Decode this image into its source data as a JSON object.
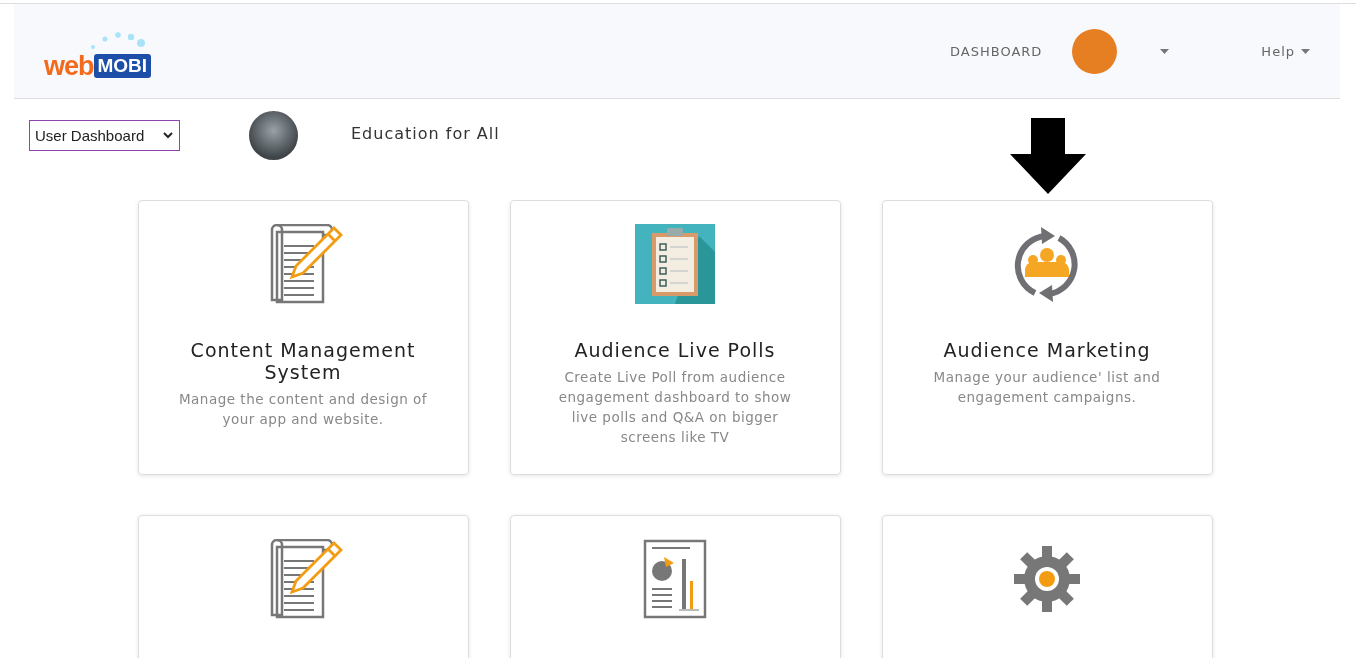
{
  "header": {
    "logo": {
      "part_1": "web",
      "part_2": "MOBI"
    },
    "nav": [
      {
        "label": "DASHBOARD",
        "kind": "link"
      },
      {
        "kind": "avatar",
        "color": "#e67e22"
      },
      {
        "kind": "caret"
      },
      {
        "label": "Help",
        "kind": "dropdown"
      }
    ]
  },
  "toolbar": {
    "view_select": {
      "value": "User Dashboard"
    },
    "app_name": "Education for All"
  },
  "cards": [
    {
      "kind": "document-pencil",
      "title": "Content Management System",
      "description": "Manage the content and design of your app and website."
    },
    {
      "kind": "clipboard",
      "title": "Audience Live Polls",
      "description": "Create Live Poll from audience engagement dashboard to show live polls and Q&A on bigger screens like TV"
    },
    {
      "kind": "audience-cycle",
      "title": "Audience Marketing",
      "description": "Manage your audience' list and engagement campaigns.",
      "pointed": true
    },
    {
      "kind": "document-pencil"
    },
    {
      "kind": "report"
    },
    {
      "kind": "gear"
    }
  ]
}
